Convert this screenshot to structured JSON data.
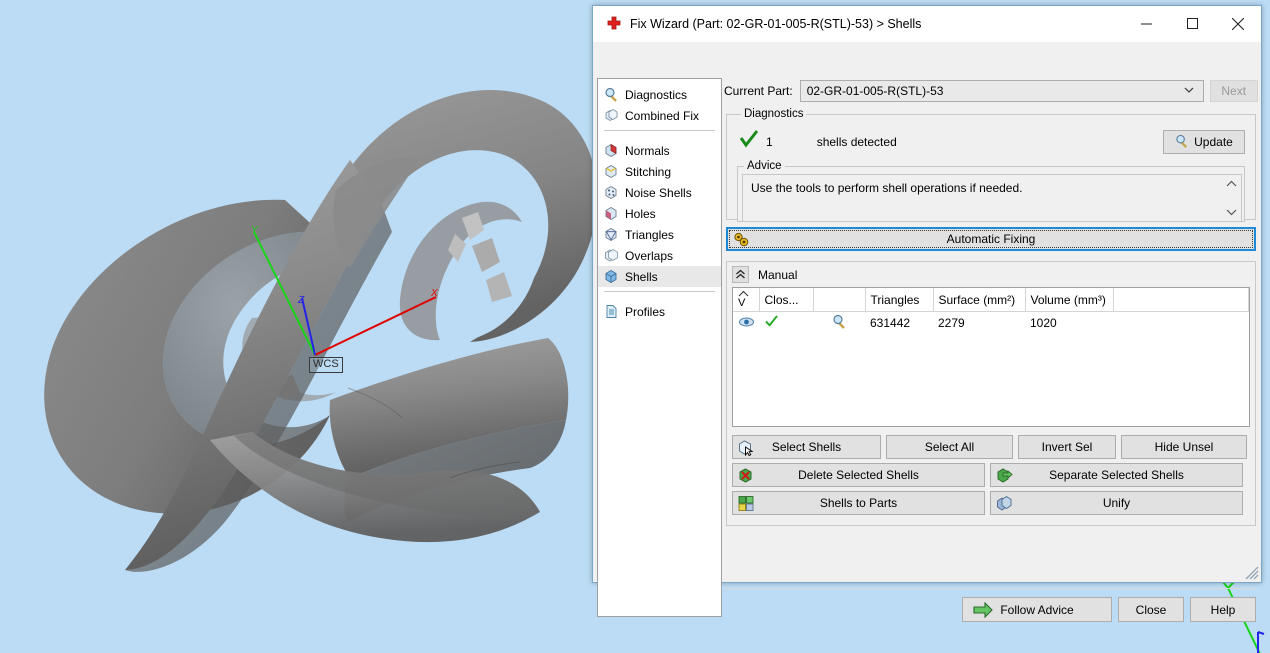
{
  "viewport": {
    "background_color": "#bcdcf5",
    "model_color": "#7e7e7e",
    "wcs_label": "WCS",
    "axes": [
      {
        "name": "x-axis",
        "letter": "X",
        "color": "#e00000"
      },
      {
        "name": "y-axis",
        "letter": "Y",
        "color": "#19d419"
      },
      {
        "name": "z-axis",
        "letter": "Z",
        "color": "#2424e6"
      }
    ],
    "corner_axes": [
      {
        "name": "y-axis",
        "letter": "Y",
        "color": "#19d419"
      },
      {
        "name": "z-axis",
        "letter": "Z",
        "color": "#2424e6"
      }
    ]
  },
  "dialog": {
    "title": "Fix Wizard (Part: 02-GR-01-005-R(STL)-53) > Shells",
    "app_icon": "red-cross-icon",
    "window_controls": {
      "minimize": "—",
      "maximize": "□",
      "close": "✕"
    },
    "accent_color": "#1e8ad6"
  },
  "current_part": {
    "label": "Current Part:",
    "value": "02-GR-01-005-R(STL)-53",
    "next_label": "Next",
    "next_disabled": true
  },
  "tree": {
    "groups": [
      {
        "items": [
          {
            "label": "Diagnostics",
            "icon": "magnifier-icon",
            "selected": false
          },
          {
            "label": "Combined Fix",
            "icon": "stacked-cubes-icon",
            "selected": false
          }
        ]
      },
      {
        "items": [
          {
            "label": "Normals",
            "icon": "cube-red-icon",
            "selected": false
          },
          {
            "label": "Stitching",
            "icon": "cube-yellow-icon",
            "selected": false
          },
          {
            "label": "Noise Shells",
            "icon": "cube-dotted-icon",
            "selected": false
          },
          {
            "label": "Holes",
            "icon": "cube-hole-icon",
            "selected": false
          },
          {
            "label": "Triangles",
            "icon": "cube-triangles-icon",
            "selected": false
          },
          {
            "label": "Overlaps",
            "icon": "cube-overlap-icon",
            "selected": false
          },
          {
            "label": "Shells",
            "icon": "cube-blue-icon",
            "selected": true
          }
        ]
      },
      {
        "items": [
          {
            "label": "Profiles",
            "icon": "document-icon",
            "selected": false
          }
        ]
      }
    ]
  },
  "diagnostics": {
    "legend": "Diagnostics",
    "status_icon": "green-check-icon",
    "count": "1",
    "message": "shells detected",
    "update_label": "Update",
    "update_icon": "magnifier-icon"
  },
  "advice": {
    "legend": "Advice",
    "text": "Use the tools to perform shell operations if needed.",
    "scroll_up": "⌃",
    "scroll_down": "⌄"
  },
  "automatic_fixing": {
    "label": "Automatic Fixing",
    "icon": "gears-icon",
    "focused": true
  },
  "manual": {
    "label": "Manual",
    "collapse_icon": "chevron-double-up-icon",
    "table": {
      "columns": [
        "V",
        "Clos...",
        "",
        "Triangles",
        "Surface (mm²)",
        "Volume (mm³)"
      ],
      "rows": [
        {
          "visible_icon": "eye-icon",
          "closed_icon": "green-check-icon",
          "zoom_icon": "magnifier-icon",
          "triangles": "631442",
          "surface": "2279",
          "volume": "1020"
        }
      ]
    },
    "buttons_row1": [
      {
        "label": "Select Shells",
        "icon": "cube-cursor-icon"
      },
      {
        "label": "Select All",
        "icon": ""
      },
      {
        "label": "Invert Sel",
        "icon": ""
      },
      {
        "label": "Hide Unsel",
        "icon": ""
      }
    ],
    "buttons_row2": [
      {
        "label": "Delete Selected Shells",
        "icon": "cube-delete-icon"
      },
      {
        "label": "Separate Selected Shells",
        "icon": "cube-arrow-icon"
      }
    ],
    "buttons_row3": [
      {
        "label": "Shells to Parts",
        "icon": "cubes-multi-icon"
      },
      {
        "label": "Unify",
        "icon": "cubes-merge-icon"
      }
    ]
  },
  "footer": {
    "follow_advice": "Follow Advice",
    "follow_advice_icon": "green-arrow-icon",
    "close": "Close",
    "help": "Help"
  }
}
